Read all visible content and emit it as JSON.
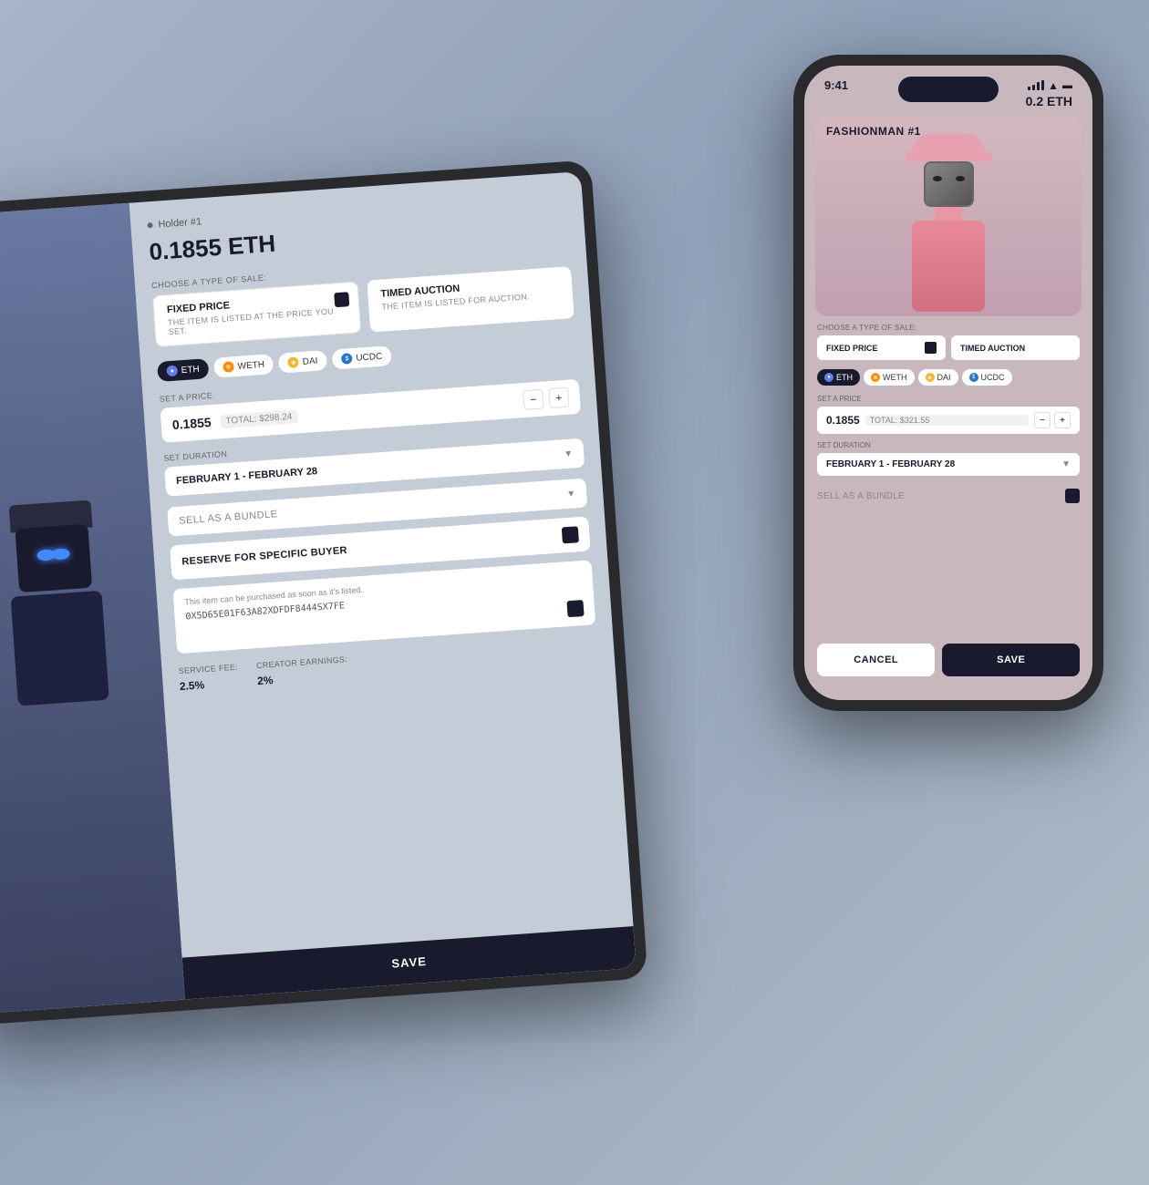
{
  "background": {
    "color1": "#a8b4c8",
    "color2": "#8fa0b8"
  },
  "tablet": {
    "holder_label": "Holder #1",
    "price": "0.1855 ETH",
    "sale_type_section_label": "Choose a type of sale:",
    "sale_options": [
      {
        "title": "FIXED PRICE",
        "description": "THE ITEM IS LISTED AT THE PRICE YOU SET.",
        "active": true
      },
      {
        "title": "TIMED AUCTION",
        "description": "THE ITEM IS LISTED FOR AUCTION.",
        "active": false
      }
    ],
    "currencies": [
      {
        "name": "ETH",
        "symbol": "♦",
        "active": true
      },
      {
        "name": "WETH",
        "symbol": "⊕",
        "active": false
      },
      {
        "name": "DAI",
        "symbol": "◈",
        "active": false
      },
      {
        "name": "UCDC",
        "symbol": "$",
        "active": false
      }
    ],
    "price_label": "Set a price",
    "price_value": "0.1855",
    "price_total": "TOTAL: $298.24",
    "duration_label": "Set duration",
    "duration_value": "FEBRUARY 1 - FEBRUARY 28",
    "bundle_label": "SELL AS A BUNDLE",
    "reserve_label": "RESERVE FOR SPECIFIC BUYER",
    "purchase_label": "This item can be purchased as soon as it's listed.",
    "wallet_address": "0X5D65E01F63A82XDFDF8444SX7FE",
    "service_fee_label": "SERVICE FEE:",
    "service_fee_value": "2.5%",
    "creator_earnings_label": "CREATOR EARNINGS:",
    "creator_earnings_value": "2%",
    "save_label": "SAVE"
  },
  "phone": {
    "time": "9:41",
    "price_top": "0.2 ETH",
    "nft_title": "FASHIONMAN #1",
    "sale_type_section_label": "Choose a type of sale:",
    "sale_options": [
      {
        "title": "FIXED PRICE",
        "active": true
      },
      {
        "title": "TIMED AUCTION",
        "active": false
      }
    ],
    "currencies": [
      {
        "name": "ETH",
        "symbol": "♦",
        "active": true
      },
      {
        "name": "WETH",
        "symbol": "⊕",
        "active": false
      },
      {
        "name": "DAI",
        "symbol": "◈",
        "active": false
      },
      {
        "name": "UCDC",
        "symbol": "$",
        "active": false
      }
    ],
    "price_label": "Set a price",
    "price_value": "0.1855",
    "price_total": "TOTAL: $321.55",
    "duration_label": "Set duration",
    "duration_value": "FEBRUARY 1 - FEBRUARY 28",
    "bundle_label": "SELL AS A BUNDLE",
    "stepper_minus": "−",
    "stepper_plus": "+",
    "cancel_label": "CANCEL",
    "save_label": "SAVE"
  }
}
